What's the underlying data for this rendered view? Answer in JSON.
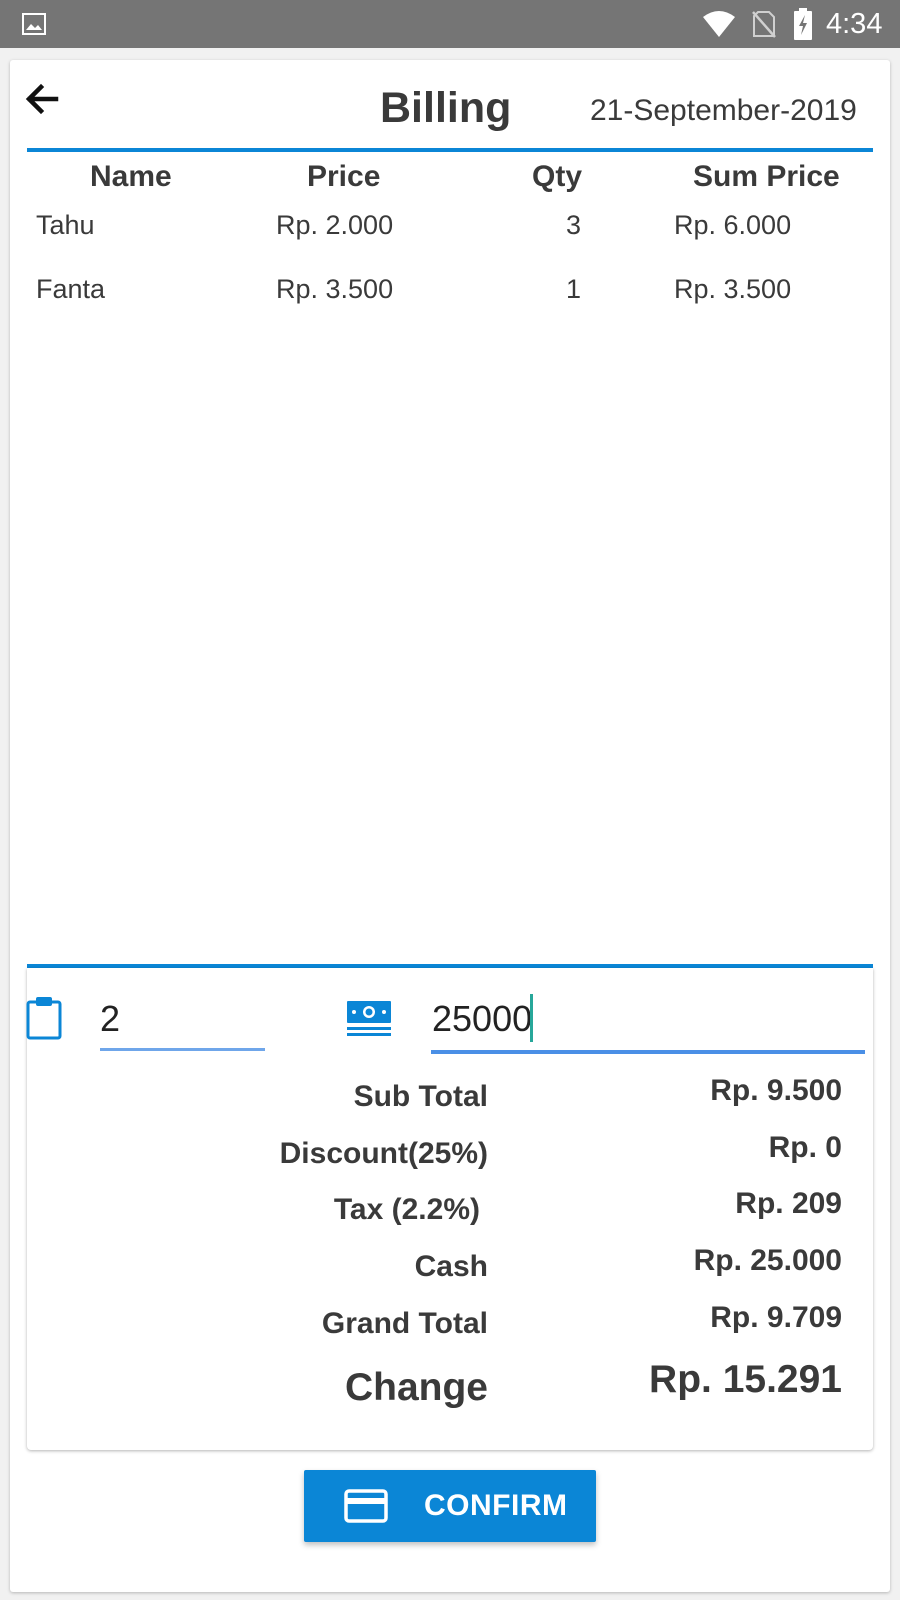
{
  "status_bar": {
    "time": "4:34"
  },
  "header": {
    "title": "Billing",
    "date": "21-September-2019"
  },
  "table": {
    "columns": [
      "Name",
      "Price",
      "Qty",
      "Sum Price"
    ],
    "rows": [
      {
        "name": "Tahu",
        "price": "Rp. 2.000",
        "qty": "3",
        "sum_price": "Rp. 6.000"
      },
      {
        "name": "Fanta",
        "price": "Rp. 3.500",
        "qty": "1",
        "sum_price": "Rp. 3.500"
      }
    ]
  },
  "inputs": {
    "items_value": "2",
    "cash_value": "25000"
  },
  "summary": {
    "sub_total_label": "Sub Total",
    "sub_total_value": "Rp. 9.500",
    "discount_label": "Discount(25%)",
    "discount_value": "Rp. 0",
    "tax_label": "Tax (2.2%)",
    "tax_value": "Rp. 209",
    "cash_label": "Cash",
    "cash_value": "Rp. 25.000",
    "grand_total_label": "Grand Total",
    "grand_total_value": "Rp. 9.709",
    "change_label": "Change",
    "change_value": "Rp. 15.291"
  },
  "confirm": {
    "label": "CONFIRM"
  },
  "colors": {
    "accent": "#0b86d6",
    "text": "#3a3a3a",
    "status_bar": "#757575",
    "input_underline": "#4a8fe6"
  },
  "icons": [
    "gallery-icon",
    "wifi-icon",
    "no-sim-icon",
    "battery-charging-icon",
    "back-arrow-icon",
    "clipboard-icon",
    "cash-icon",
    "credit-card-icon"
  ]
}
